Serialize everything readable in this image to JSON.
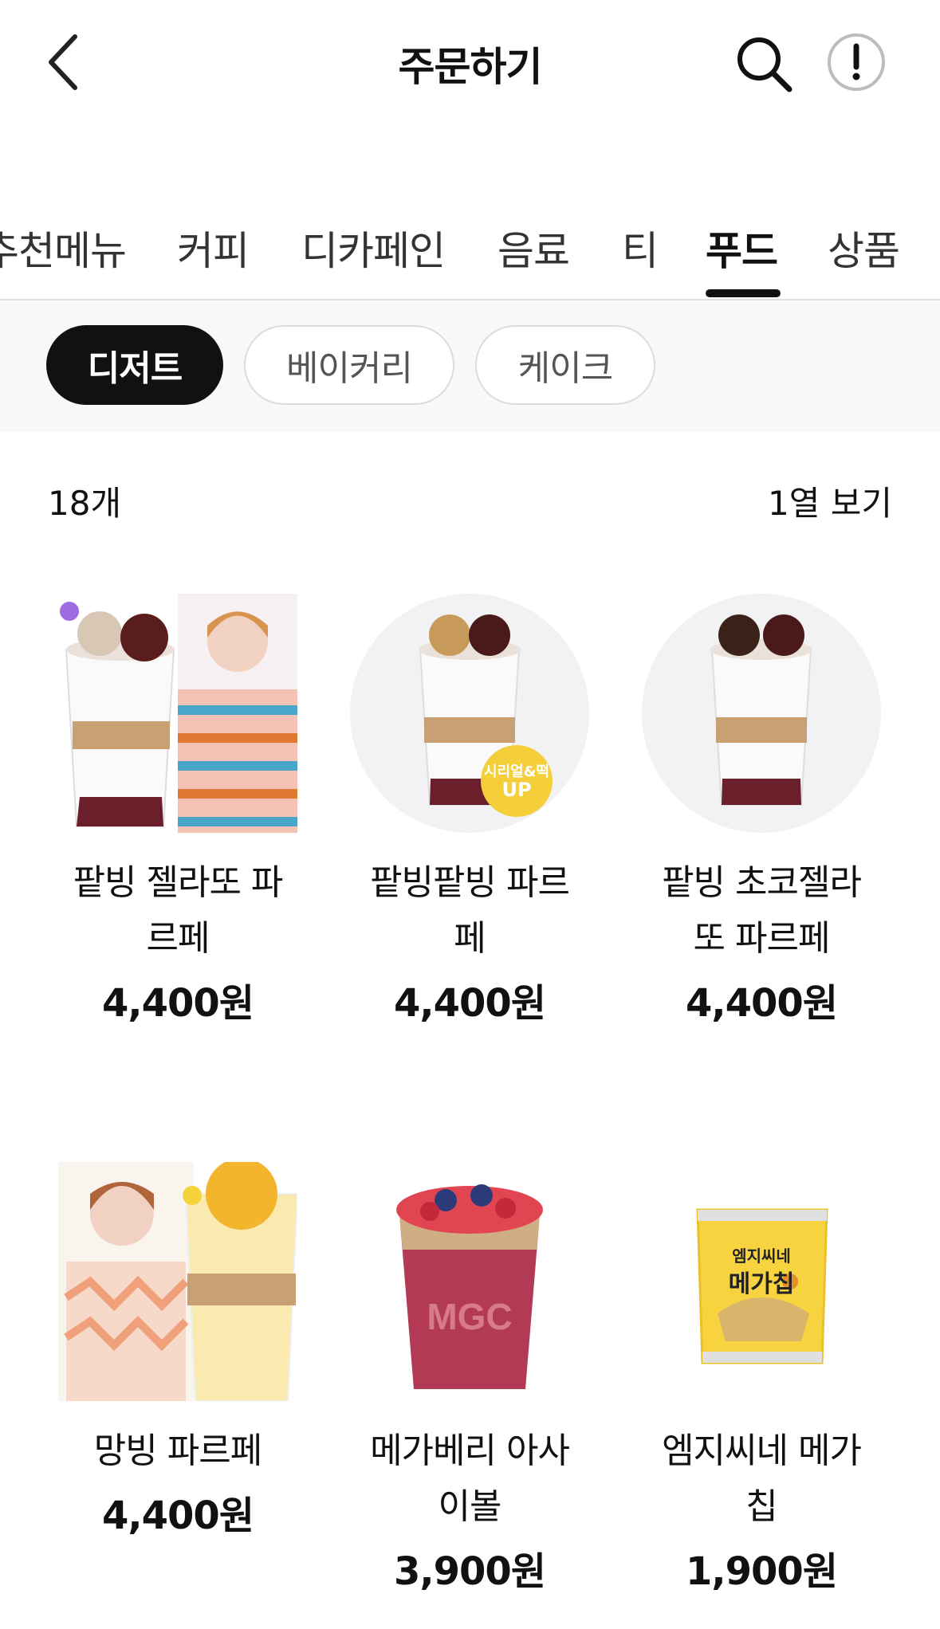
{
  "header": {
    "title": "주문하기"
  },
  "tabs": [
    {
      "label": "추천메뉴",
      "active": false
    },
    {
      "label": "커피",
      "active": false
    },
    {
      "label": "디카페인",
      "active": false
    },
    {
      "label": "음료",
      "active": false
    },
    {
      "label": "티",
      "active": false
    },
    {
      "label": "푸드",
      "active": true
    },
    {
      "label": "상품",
      "active": false
    }
  ],
  "chips": [
    {
      "label": "디저트",
      "active": true
    },
    {
      "label": "베이커리",
      "active": false
    },
    {
      "label": "케이크",
      "active": false
    }
  ],
  "list": {
    "count": "18개",
    "view_toggle": "1열 보기"
  },
  "products": [
    {
      "name_line1": "팥빙 젤라또 파",
      "name_line2": "르페",
      "price": "4,400원"
    },
    {
      "name_line1": "팥빙팥빙 파르",
      "name_line2": "페",
      "price": "4,400원",
      "badge_line1": "시리얼&떡",
      "badge_line2": "UP"
    },
    {
      "name_line1": "팥빙 초코젤라",
      "name_line2": "또 파르페",
      "price": "4,400원"
    },
    {
      "name_line1": "망빙 파르페",
      "name_line2": "",
      "price": "4,400원"
    },
    {
      "name_line1": "메가베리 아사",
      "name_line2": "이볼",
      "price": "3,900원",
      "cup_logo": "MGC"
    },
    {
      "name_line1": "엠지씨네 메가",
      "name_line2": "칩",
      "price": "1,900원",
      "pack_line1": "엠지씨네",
      "pack_line2": "메가칩"
    }
  ],
  "colors": {
    "accent": "#111111",
    "chipbar_bg": "#f7f8fa",
    "thumb_bg": "#f2f2f4",
    "badge": "#f4cf3a"
  }
}
